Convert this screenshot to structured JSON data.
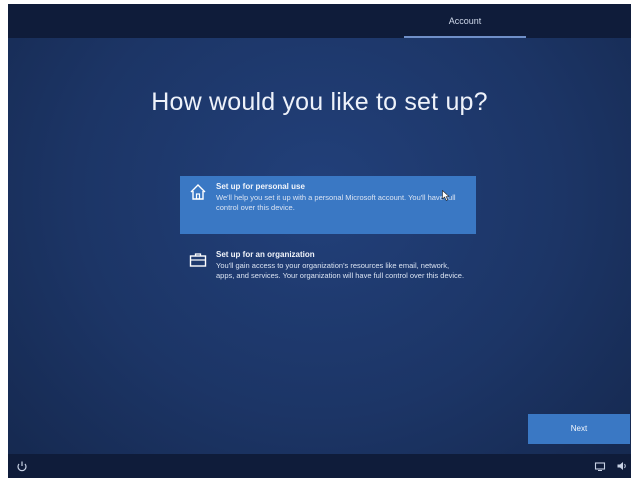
{
  "header": {
    "tab_label": "Account"
  },
  "main": {
    "title": "How would you like to set up?",
    "options": [
      {
        "icon": "home-icon",
        "title": "Set up for personal use",
        "description": "We'll help you set it up with a personal Microsoft account. You'll have full control over this device.",
        "selected": true
      },
      {
        "icon": "briefcase-icon",
        "title": "Set up for an organization",
        "description": "You'll gain access to your organization's resources like email, network, apps, and services. Your organization will have full control over this device.",
        "selected": false
      }
    ],
    "next_label": "Next"
  },
  "footer": {
    "icons": [
      "accessibility-icon",
      "network-icon",
      "volume-icon"
    ]
  },
  "colors": {
    "background": "#1c3566",
    "accent": "#3a78c4",
    "bar": "#0f1c3a"
  }
}
